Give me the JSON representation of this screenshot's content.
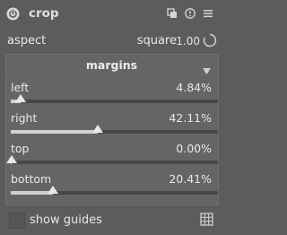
{
  "module": {
    "title": "crop",
    "icons": [
      "power-icon",
      "presets-icon",
      "reset-icon",
      "menu-icon"
    ]
  },
  "aspect": {
    "label": "aspect",
    "value": "square",
    "ratio": "1.00"
  },
  "margins": {
    "title": "margins",
    "sliders": [
      {
        "label": "left",
        "value": "4.84%",
        "fraction": 0.0484
      },
      {
        "label": "right",
        "value": "42.11%",
        "fraction": 0.4211
      },
      {
        "label": "top",
        "value": "0.00%",
        "fraction": 0.0
      },
      {
        "label": "bottom",
        "value": "20.41%",
        "fraction": 0.2041
      }
    ]
  },
  "guides": {
    "label": "show guides",
    "checked": false
  },
  "colors": {
    "background": "#5c5c5c",
    "panel": "#656565",
    "text": "#e6e6e6",
    "track": "#474747",
    "fill": "#d0d0d0"
  }
}
